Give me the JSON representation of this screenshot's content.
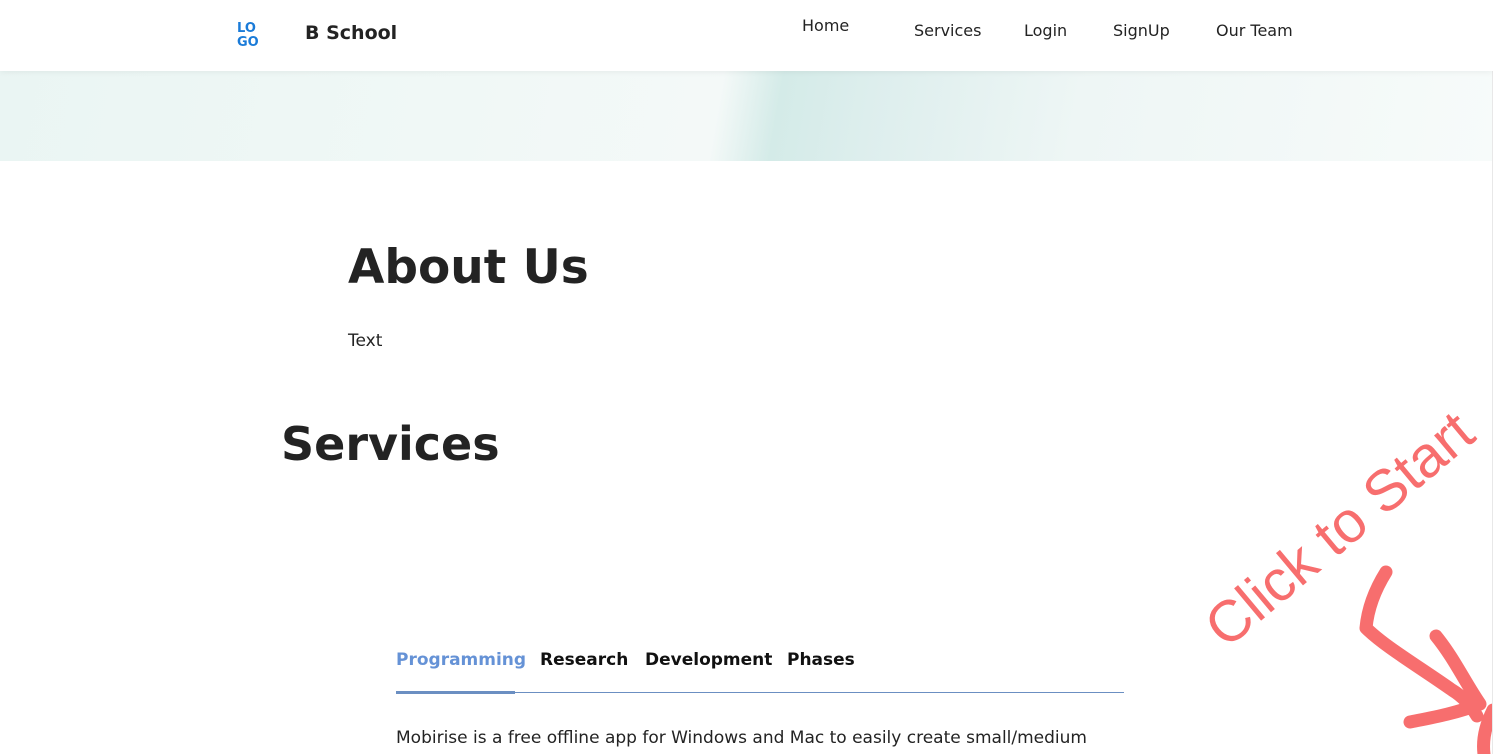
{
  "navbar": {
    "brand": "B School",
    "logo_letters_top": "LO",
    "logo_letters_bottom": "GO",
    "items": [
      {
        "label": "Home"
      },
      {
        "label": "Services"
      },
      {
        "label": "Login"
      },
      {
        "label": "SignUp"
      },
      {
        "label": "Our Team"
      }
    ]
  },
  "about": {
    "title": "About Us",
    "text": "Text"
  },
  "services": {
    "title": "Services",
    "tabs": [
      {
        "label": "Programming",
        "active": true
      },
      {
        "label": "Research",
        "active": false
      },
      {
        "label": "Development",
        "active": false
      },
      {
        "label": "Phases",
        "active": false
      }
    ],
    "description": "Mobirise is a free offline app for Windows and Mac to easily create small/medium"
  },
  "overlay": {
    "cta_text": "Click to Start",
    "arrow_icon": "curved-arrow-icon"
  },
  "colors": {
    "accent": "#6592d6",
    "logo": "#1a7bd8",
    "cta": "#f76e6e",
    "hero_tint": "#d4ebe8"
  }
}
